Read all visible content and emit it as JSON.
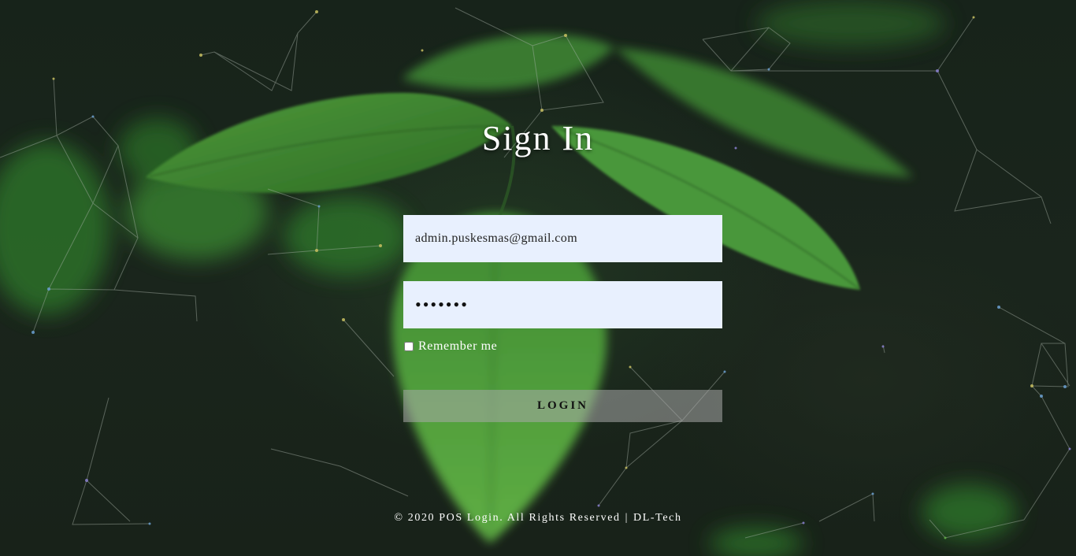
{
  "page": {
    "title": "Sign In"
  },
  "form": {
    "email_value": "admin.puskesmas@gmail.com",
    "password_value": "passwor",
    "remember_label": "Remember me",
    "remember_checked": false,
    "login_label": "LOGIN"
  },
  "footer": {
    "copyright": "© 2020 POS Login. All Rights Reserved",
    "separator": "|",
    "brand": "DL-Tech"
  },
  "colors": {
    "input_background": "#e8f0fe",
    "button_background": "rgba(170,170,170,0.55)",
    "text": "#ffffff",
    "page_background": "#18221a"
  }
}
